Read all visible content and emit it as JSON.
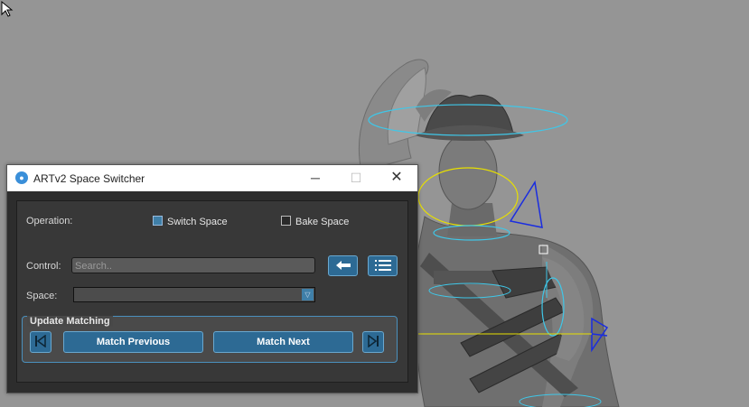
{
  "window": {
    "title": "ARTv2 Space Switcher",
    "minimize_glyph": "─",
    "maximize_glyph": "☐",
    "close_glyph": "✕"
  },
  "operation": {
    "label": "Operation:",
    "switch_space": {
      "label": "Switch Space",
      "checked": true
    },
    "bake_space": {
      "label": "Bake Space",
      "checked": false
    }
  },
  "control": {
    "label": "Control:",
    "search_placeholder": "Search..",
    "back_icon": "arrow-left-icon",
    "list_icon": "list-icon"
  },
  "space": {
    "label": "Space:",
    "selected": ""
  },
  "update_matching": {
    "title": "Update Matching",
    "match_previous": "Match Previous",
    "match_next": "Match Next"
  },
  "colors": {
    "accent": "#2d6a94",
    "accent_border": "#6aa8cf",
    "viewport_bg": "#959595",
    "rig_cyan": "#3fc7e8",
    "rig_yellow": "#e8e000",
    "rig_blue": "#1a2de0"
  }
}
